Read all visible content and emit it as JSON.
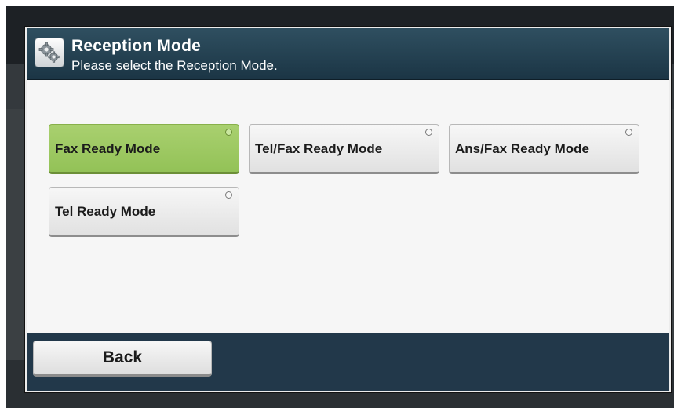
{
  "header": {
    "title": "Reception Mode",
    "subtitle": "Please select the Reception Mode.",
    "icon": "gear-icon"
  },
  "modes": [
    {
      "label": "Fax Ready Mode",
      "selected": true
    },
    {
      "label": "Tel/Fax Ready Mode",
      "selected": false
    },
    {
      "label": "Ans/Fax Ready Mode",
      "selected": false
    },
    {
      "label": "Tel Ready Mode",
      "selected": false
    }
  ],
  "footer": {
    "back_label": "Back"
  },
  "colors": {
    "header_bg": "#1f3b4c",
    "selected_button": "#9fca62",
    "button": "#eaeaea",
    "footer_bg": "#22384a"
  }
}
